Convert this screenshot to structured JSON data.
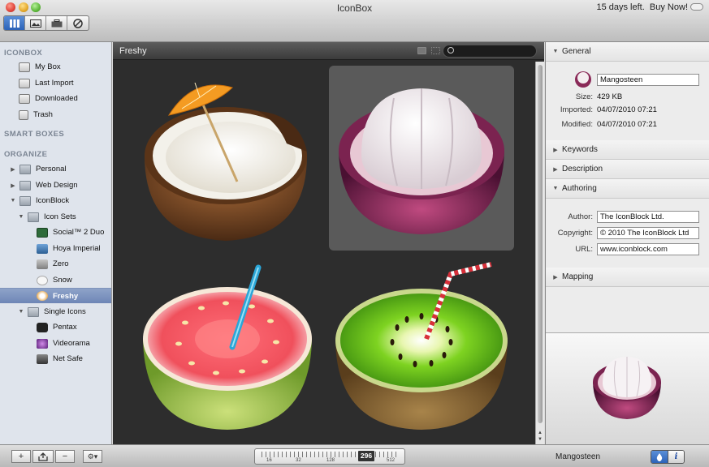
{
  "window": {
    "title": "IconBox",
    "trial_text": "15 days left.",
    "buy_label": "Buy Now!"
  },
  "toolbar": {
    "buttons": [
      "grid-view-icon",
      "preview-icon",
      "box-icon",
      "settings-icon"
    ]
  },
  "sidebar": {
    "sections": [
      "ICONBOX",
      "SMART BOXES",
      "ORGANIZE"
    ],
    "iconbox_items": [
      "My Box",
      "Last Import",
      "Downloaded",
      "Trash"
    ],
    "organize_items": [
      {
        "label": "Personal"
      },
      {
        "label": "Web Design"
      },
      {
        "label": "IconBlock"
      },
      {
        "label": "Icon Sets"
      },
      {
        "label": "Social™ 2 Duo"
      },
      {
        "label": "Hoya Imperial"
      },
      {
        "label": "Zero"
      },
      {
        "label": "Snow"
      },
      {
        "label": "Freshy"
      },
      {
        "label": "Single Icons"
      },
      {
        "label": "Pentax"
      },
      {
        "label": "Videorama"
      },
      {
        "label": "Net Safe"
      }
    ]
  },
  "main": {
    "title": "Freshy",
    "search_placeholder": "",
    "icons": [
      "coconut-icon",
      "mangosteen-icon",
      "guava-icon",
      "kiwi-icon"
    ],
    "selected_icon": "mangosteen-icon"
  },
  "info": {
    "general_label": "General",
    "name": "Mangosteen",
    "size_label": "Size:",
    "size": "429 KB",
    "imported_label": "Imported:",
    "imported": "04/07/2010 07:21",
    "modified_label": "Modified:",
    "modified": "04/07/2010 07:21",
    "keywords_label": "Keywords",
    "description_label": "Description",
    "authoring_label": "Authoring",
    "author_label": "Author:",
    "author": "The IconBlock Ltd.",
    "copyright_label": "Copyright:",
    "copyright": "© 2010 The IconBlock Ltd",
    "url_label": "URL:",
    "url": "www.iconblock.com",
    "mapping_label": "Mapping"
  },
  "bottom": {
    "add_label": "+",
    "remove_label": "−",
    "action_label": "⚙▾",
    "slider_ticks": [
      "16",
      "32",
      "128",
      "512"
    ],
    "slider_value": "296",
    "status_text": "Mangosteen",
    "info_label": "i"
  },
  "colors": {
    "accent": "#2c63b8",
    "sidebar_bg": "#dfe4ec",
    "main_bg": "#2d2d2d"
  }
}
